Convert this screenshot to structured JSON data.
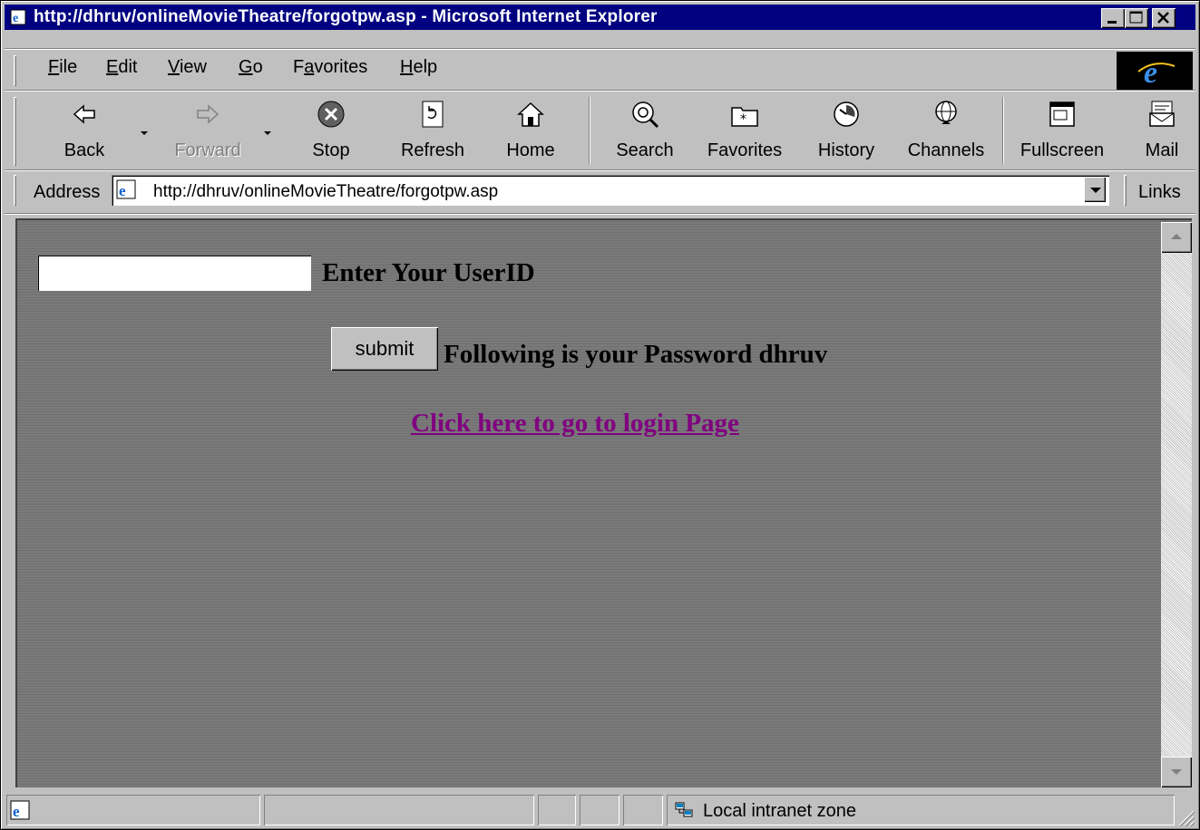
{
  "window": {
    "title": "http://dhruv/onlineMovieTheatre/forgotpw.asp - Microsoft Internet Explorer",
    "title_bg": "#000080"
  },
  "menu": {
    "items": [
      {
        "label": "File",
        "accel": "F"
      },
      {
        "label": "Edit",
        "accel": "E"
      },
      {
        "label": "View",
        "accel": "V"
      },
      {
        "label": "Go",
        "accel": "G"
      },
      {
        "label": "Favorites",
        "accel": "a"
      },
      {
        "label": "Help",
        "accel": "H"
      }
    ]
  },
  "toolbar": {
    "back": "Back",
    "forward": "Forward",
    "stop": "Stop",
    "refresh": "Refresh",
    "home": "Home",
    "search": "Search",
    "favorites": "Favorites",
    "history": "History",
    "channels": "Channels",
    "fullscreen": "Fullscreen",
    "mail": "Mail"
  },
  "address": {
    "label": "Address",
    "url": "http://dhruv/onlineMovieTheatre/forgotpw.asp",
    "links_label": "Links"
  },
  "page": {
    "userid_label": "Enter Your UserID",
    "userid_value": "",
    "submit_label": "submit",
    "password_message": "Following is your Password dhruv",
    "login_link": "Click here to go to login Page",
    "link_color": "#800080"
  },
  "status": {
    "zone": "Local intranet zone"
  }
}
